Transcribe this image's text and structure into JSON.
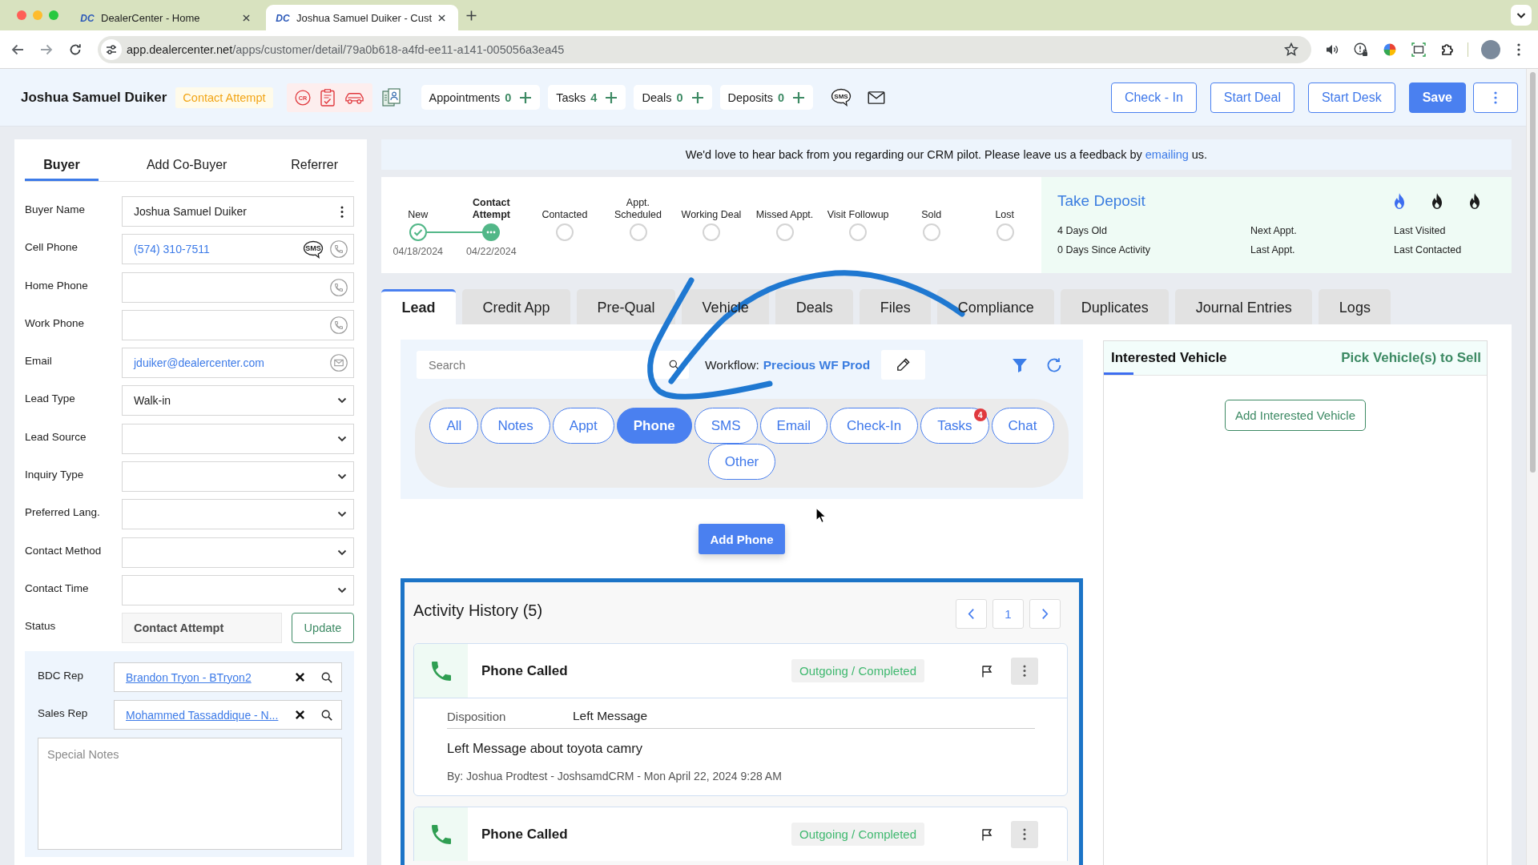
{
  "browser": {
    "tabs": [
      {
        "favicon_text": "DC",
        "title": "DealerCenter - Home",
        "selected": false
      },
      {
        "favicon_text": "DC",
        "title": "Joshua Samuel Duiker - Cust",
        "selected": true
      }
    ],
    "url_host": "app.dealercenter.net",
    "url_path": "/apps/customer/detail/79a0b618-a4fd-ee11-a141-005056a3ea45"
  },
  "header": {
    "customer_name": "Joshua Samuel Duiker",
    "status": "Contact Attempt",
    "tools": [
      {
        "kind": "credit-report",
        "text": "CR"
      },
      {
        "kind": "checklist"
      },
      {
        "kind": "car"
      }
    ],
    "counters": [
      {
        "label": "Appointments",
        "count": "0"
      },
      {
        "label": "Tasks",
        "count": "4"
      },
      {
        "label": "Deals",
        "count": "0"
      },
      {
        "label": "Deposits",
        "count": "0"
      }
    ],
    "sms_icon_text": "SMS",
    "buttons": [
      {
        "label": "Check - In",
        "kind": "outline"
      },
      {
        "label": "Start Deal",
        "kind": "outline"
      },
      {
        "label": "Start Desk",
        "kind": "outline"
      },
      {
        "label": "Save",
        "kind": "primary"
      }
    ]
  },
  "buyer_panel": {
    "tabs": [
      {
        "label": "Buyer",
        "selected": true
      },
      {
        "label": "Add Co-Buyer",
        "selected": false
      },
      {
        "label": "Referrer",
        "selected": false
      }
    ],
    "fields": [
      {
        "label": "Buyer Name",
        "kind": "text",
        "value": "Joshua Samuel Duiker"
      },
      {
        "label": "Cell Phone",
        "kind": "phone",
        "value": "(574) 310-7511",
        "sms_icon_text": "SMS"
      },
      {
        "label": "Home Phone",
        "kind": "phone"
      },
      {
        "label": "Work Phone",
        "kind": "phone"
      },
      {
        "label": "Email",
        "kind": "email",
        "value": "jduiker@dealercenter.com"
      },
      {
        "label": "Lead Type",
        "kind": "select",
        "value": "Walk-in"
      },
      {
        "label": "Lead Source",
        "kind": "select"
      },
      {
        "label": "Inquiry Type",
        "kind": "select"
      },
      {
        "label": "Preferred Lang.",
        "kind": "select"
      },
      {
        "label": "Contact Method",
        "kind": "select"
      },
      {
        "label": "Contact Time",
        "kind": "select"
      }
    ],
    "status": {
      "label": "Status",
      "value": "Contact Attempt",
      "button": "Update"
    },
    "reps": [
      {
        "label": "BDC Rep",
        "value": "Brandon Tryon - BTryon2"
      },
      {
        "label": "Sales Rep",
        "value": "Mohammed Tassaddique - N..."
      }
    ],
    "special_notes": {
      "placeholder": "Special Notes"
    }
  },
  "feedback_banner": {
    "text": "We'd love to hear back from you regarding our CRM pilot. Please leave us a feedback by",
    "link": "emailing",
    "text_after": "us."
  },
  "pipeline": {
    "stages": [
      {
        "label": "New",
        "completed": true,
        "current": false,
        "date": "04/18/2024"
      },
      {
        "label": "Contact Attempt",
        "completed": false,
        "current": true,
        "date": "04/22/2024"
      },
      {
        "label": "Contacted",
        "completed": false,
        "current": false
      },
      {
        "label": "Appt. Scheduled",
        "completed": false,
        "current": false
      },
      {
        "label": "Working Deal",
        "completed": false,
        "current": false
      },
      {
        "label": "Missed Appt.",
        "completed": false,
        "current": false
      },
      {
        "label": "Visit Followup",
        "completed": false,
        "current": false
      },
      {
        "label": "Sold",
        "completed": false,
        "current": false
      },
      {
        "label": "Lost",
        "completed": false,
        "current": false
      }
    ]
  },
  "deposit": {
    "title": "Take Deposit",
    "flames": [
      {
        "active": true
      },
      {
        "active": false
      },
      {
        "active": false
      }
    ],
    "facts": [
      "4 Days Old",
      "Next Appt.",
      "Last Visited",
      "0 Days Since Activity",
      "Last Appt.",
      "Last Contacted"
    ]
  },
  "tabs": [
    {
      "label": "Lead",
      "selected": true
    },
    {
      "label": "Credit App",
      "selected": false
    },
    {
      "label": "Pre-Qual",
      "selected": false
    },
    {
      "label": "Vehicle",
      "selected": false
    },
    {
      "label": "Deals",
      "selected": false
    },
    {
      "label": "Files",
      "selected": false
    },
    {
      "label": "Compliance",
      "selected": false
    },
    {
      "label": "Duplicates",
      "selected": false
    },
    {
      "label": "Journal Entries",
      "selected": false
    },
    {
      "label": "Logs",
      "selected": false
    }
  ],
  "lead": {
    "search": {
      "placeholder": "Search"
    },
    "workflow_label": "Workflow:",
    "workflow_value": "Precious WF Prod",
    "filters": [
      {
        "label": "All",
        "selected": false
      },
      {
        "label": "Notes",
        "selected": false
      },
      {
        "label": "Appt",
        "selected": false
      },
      {
        "label": "Phone",
        "selected": true
      },
      {
        "label": "SMS",
        "selected": false
      },
      {
        "label": "Email",
        "selected": false
      },
      {
        "label": "Check-In",
        "selected": false
      },
      {
        "label": "Tasks",
        "selected": false,
        "badge": "4"
      },
      {
        "label": "Chat",
        "selected": false
      },
      {
        "label": "Other",
        "selected": false
      }
    ],
    "add_button": "Add Phone"
  },
  "activity": {
    "title": "Activity History (5)",
    "page": "1",
    "entries": [
      {
        "title": "Phone Called",
        "status": "Outgoing / Completed",
        "disposition_label": "Disposition",
        "disposition_value": "Left Message",
        "note": "Left Message about toyota camry",
        "byline": "By: Joshua Prodtest - JoshsamdCRM - Mon April 22, 2024 9:28 AM"
      },
      {
        "title": "Phone Called",
        "status": "Outgoing / Completed"
      }
    ]
  },
  "interested_vehicle": {
    "tabs": [
      {
        "label": "Interested Vehicle",
        "selected": true
      }
    ],
    "link": "Pick Vehicle(s) to Sell",
    "button": "Add Interested Vehicle"
  }
}
